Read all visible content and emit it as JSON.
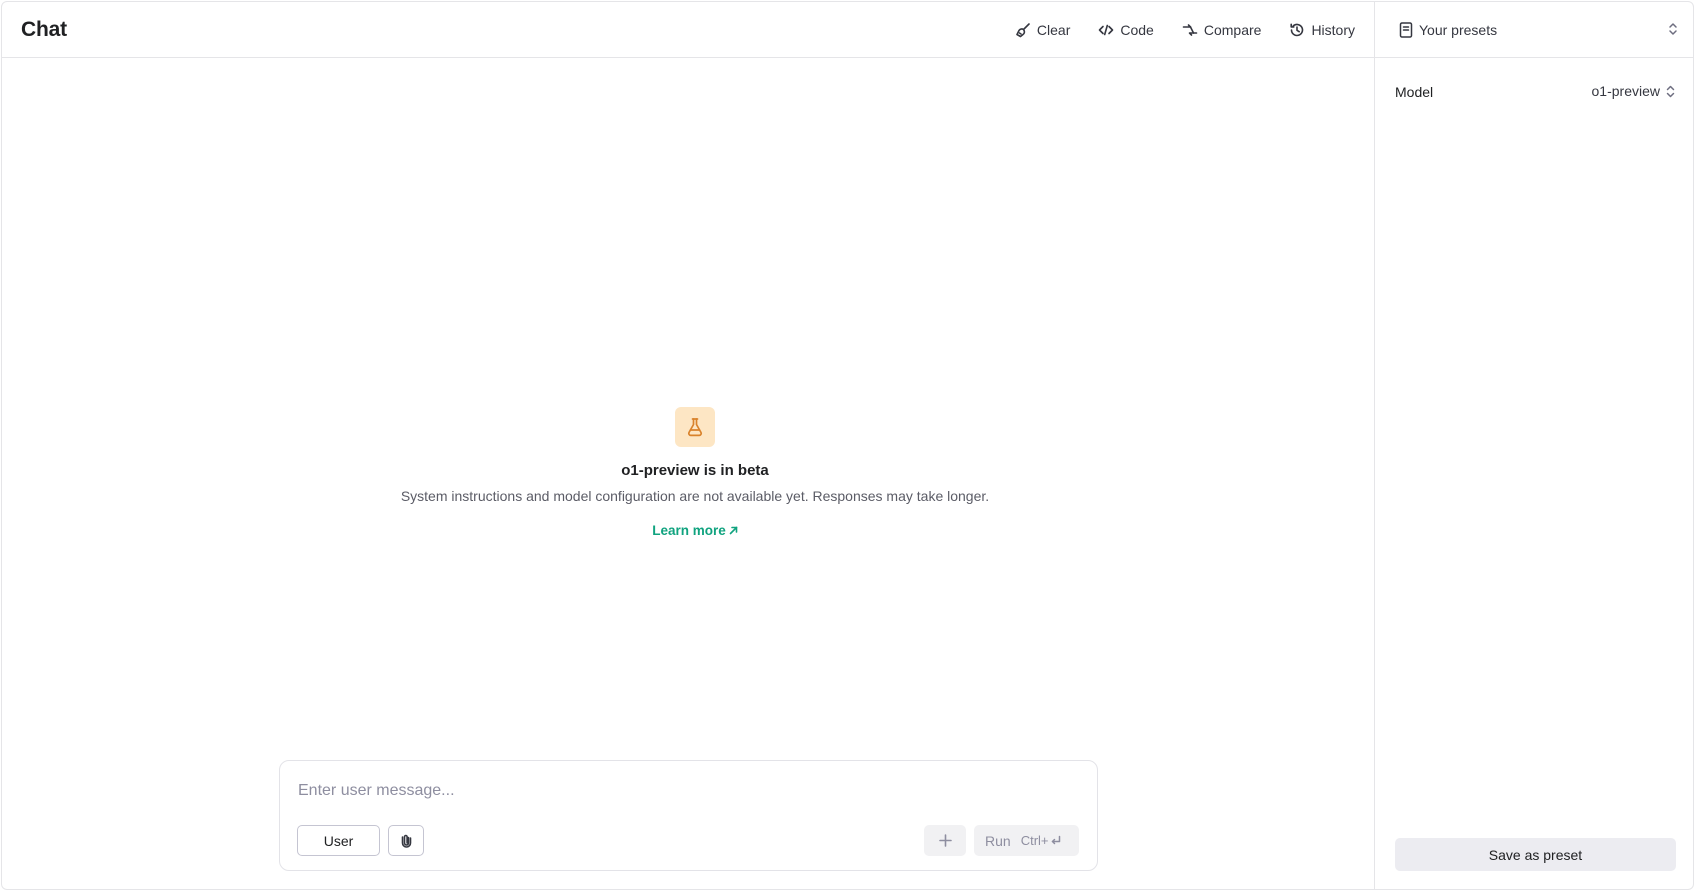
{
  "header": {
    "title": "Chat",
    "toolbar": [
      {
        "label": "Clear",
        "icon": "broom-icon"
      },
      {
        "label": "Code",
        "icon": "code-icon"
      },
      {
        "label": "Compare",
        "icon": "compare-icon"
      },
      {
        "label": "History",
        "icon": "history-icon"
      }
    ]
  },
  "empty_state": {
    "icon": "flask-icon",
    "icon_bg": "#fde6c4",
    "icon_color": "#d9822b",
    "title": "o1-preview is in beta",
    "description": "System instructions and model configuration are not available yet. Responses may take longer.",
    "link_label": "Learn more",
    "link_color": "#10a37f"
  },
  "composer": {
    "placeholder": "Enter user message...",
    "role_label": "User",
    "run_label": "Run",
    "run_shortcut": "Ctrl+"
  },
  "panel": {
    "presets_label": "Your presets",
    "model_label": "Model",
    "model_value": "o1-preview",
    "save_label": "Save as preset"
  }
}
